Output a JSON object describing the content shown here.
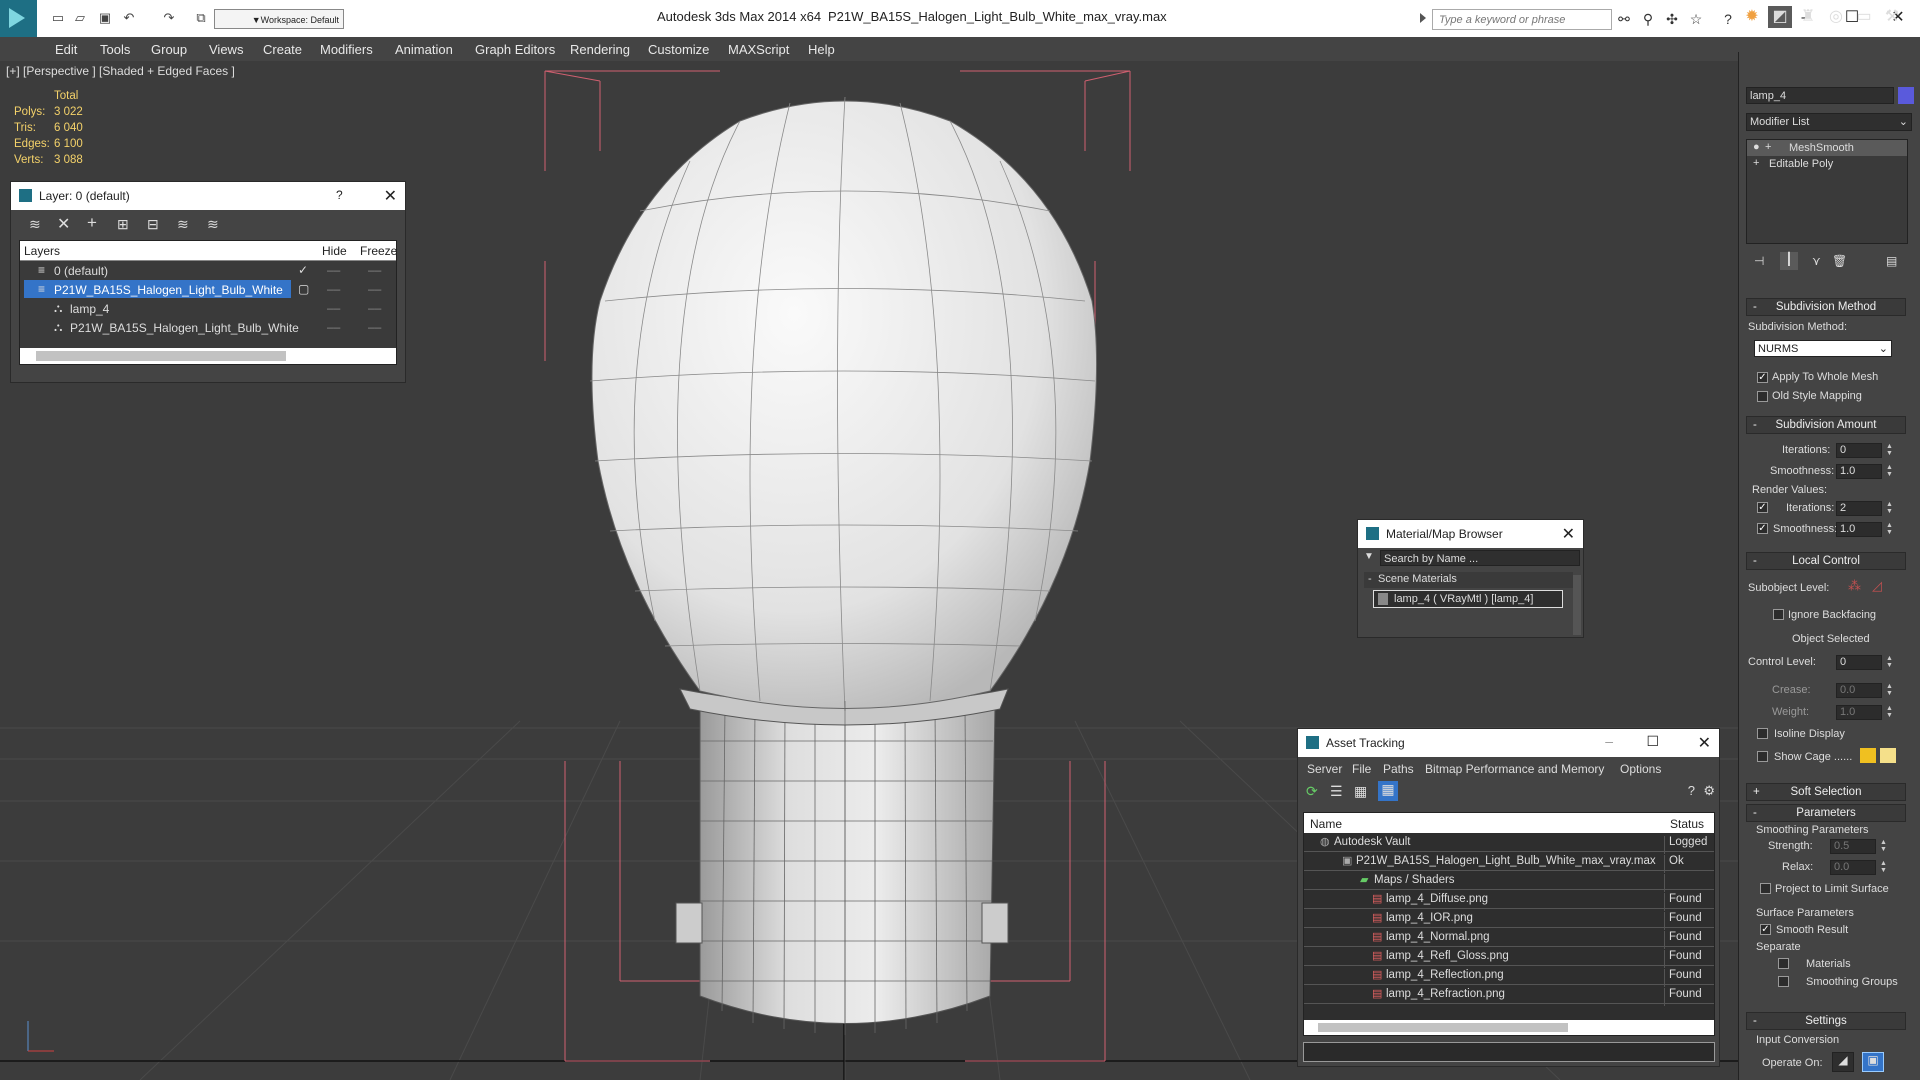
{
  "app": {
    "title": "Autodesk 3ds Max  2014 x64",
    "file": "P21W_BA15S_Halogen_Light_Bulb_White_max_vray.max",
    "workspace": "Workspace: Default",
    "search_placeholder": "Type a keyword or phrase"
  },
  "menu": [
    "Edit",
    "Tools",
    "Group",
    "Views",
    "Create",
    "Modifiers",
    "Animation",
    "Graph Editors",
    "Rendering",
    "Customize",
    "MAXScript",
    "Help"
  ],
  "viewport": {
    "label": "[+] [Perspective ] [Shaded + Edged Faces ]",
    "stats_header": "Total",
    "stats": [
      {
        "k": "Polys:",
        "v": "3 022"
      },
      {
        "k": "Tris:",
        "v": "6 040"
      },
      {
        "k": "Edges:",
        "v": "6 100"
      },
      {
        "k": "Verts:",
        "v": "3 088"
      }
    ]
  },
  "layer": {
    "title": "Layer: 0 (default)",
    "help": "?",
    "cols": {
      "layers": "Layers",
      "hide": "Hide",
      "freeze": "Freeze"
    },
    "rows": [
      {
        "name": "0 (default)",
        "check": "✓"
      },
      {
        "name": "P21W_BA15S_Halogen_Light_Bulb_White",
        "selected": true
      },
      {
        "name": "lamp_4"
      },
      {
        "name": "P21W_BA15S_Halogen_Light_Bulb_White"
      }
    ]
  },
  "mat": {
    "title": "Material/Map Browser",
    "search": "Search by Name ...",
    "section": "Scene Materials",
    "item": "lamp_4  ( VRayMtl ) [lamp_4]"
  },
  "asset": {
    "title": "Asset Tracking",
    "menu": [
      "Server",
      "File",
      "Paths",
      "Bitmap Performance and Memory",
      "Options"
    ],
    "col_name": "Name",
    "col_status": "Status",
    "rows": [
      {
        "name": "Autodesk Vault",
        "status": "Logged"
      },
      {
        "name": "P21W_BA15S_Halogen_Light_Bulb_White_max_vray.max",
        "status": "Ok"
      },
      {
        "name": "Maps / Shaders",
        "status": ""
      },
      {
        "name": "lamp_4_Diffuse.png",
        "status": "Found"
      },
      {
        "name": "lamp_4_IOR.png",
        "status": "Found"
      },
      {
        "name": "lamp_4_Normal.png",
        "status": "Found"
      },
      {
        "name": "lamp_4_Refl_Gloss.png",
        "status": "Found"
      },
      {
        "name": "lamp_4_Reflection.png",
        "status": "Found"
      },
      {
        "name": "lamp_4_Refraction.png",
        "status": "Found"
      }
    ]
  },
  "cmd": {
    "object_name": "lamp_4",
    "object_color": "#5a5adc",
    "modifier_list": "Modifier List",
    "stack": [
      "MeshSmooth",
      "Editable Poly"
    ],
    "r_subdiv_method": "Subdivision Method",
    "lbl_subdiv_method": "Subdivision Method:",
    "subdiv_value": "NURMS",
    "apply_whole": "Apply To Whole Mesh",
    "old_style": "Old Style Mapping",
    "r_subdiv_amount": "Subdivision Amount",
    "iterations": "Iterations:",
    "iterations_v": "0",
    "smoothness": "Smoothness:",
    "smoothness_v": "1.0",
    "render_values": "Render Values:",
    "r_iterations_v": "2",
    "r_smoothness_v": "1.0",
    "r_local": "Local Control",
    "subobj": "Subobject Level:",
    "ignore_back": "Ignore Backfacing",
    "obj_selected": "Object Selected",
    "control_level": "Control Level:",
    "control_level_v": "0",
    "crease": "Crease:",
    "crease_v": "0.0",
    "weight": "Weight:",
    "weight_v": "1.0",
    "isoline": "Isoline Display",
    "show_cage": "Show Cage ......",
    "cage_color1": "#f0c020",
    "cage_color2": "#f5e08a",
    "r_soft": "Soft Selection",
    "r_params": "Parameters",
    "smoothing_params": "Smoothing Parameters",
    "strength": "Strength:",
    "strength_v": "0.5",
    "relax": "Relax:",
    "relax_v": "0.0",
    "project_limit": "Project to Limit Surface",
    "surface_params": "Surface Parameters",
    "smooth_result": "Smooth Result",
    "separate": "Separate",
    "materials": "Materials",
    "smoothing_groups": "Smoothing Groups",
    "r_settings": "Settings",
    "input_conversion": "Input Conversion",
    "operate_on": "Operate On:"
  }
}
